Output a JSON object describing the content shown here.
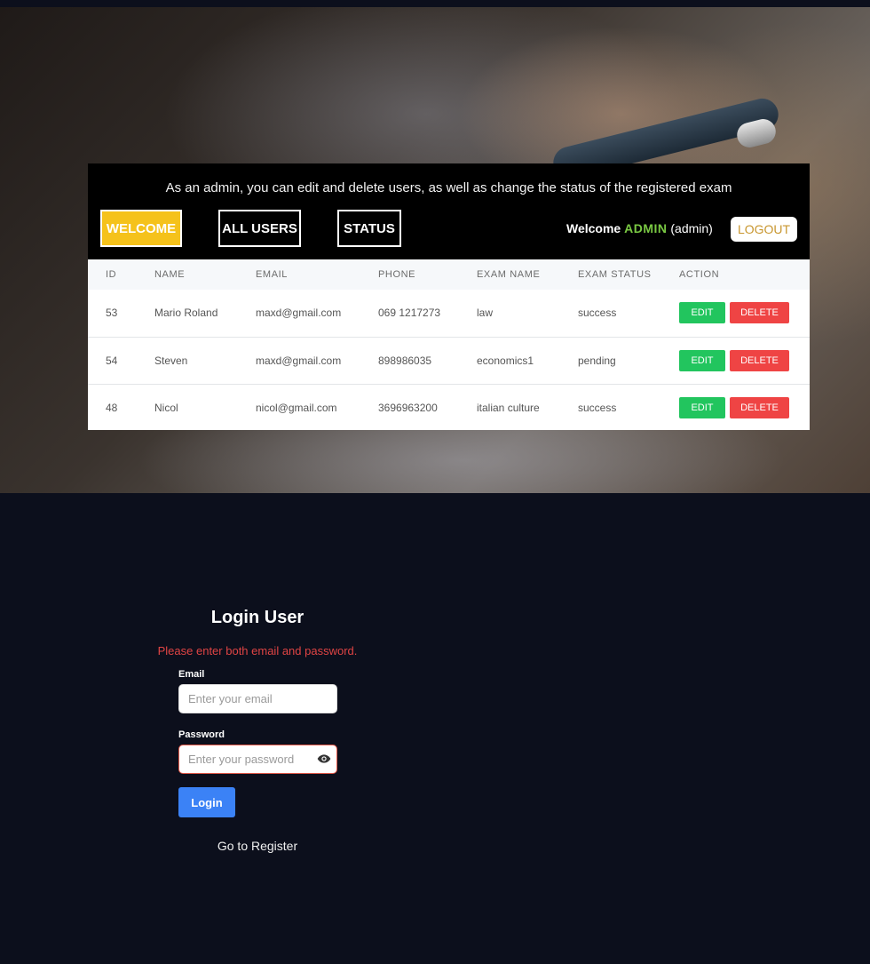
{
  "header": {
    "info_text": "As an admin, you can edit and delete users, as well as change the status of the registered exam",
    "nav": {
      "welcome": "WELCOME",
      "all_users": "ALL USERS",
      "status": "STATUS"
    },
    "welcome_prefix": "Welcome",
    "username": "ADMIN",
    "role": "(admin)",
    "logout": "LOGOUT"
  },
  "table": {
    "columns": [
      "ID",
      "NAME",
      "EMAIL",
      "PHONE",
      "EXAM NAME",
      "EXAM STATUS",
      "ACTION"
    ],
    "rows": [
      {
        "id": "53",
        "name": "Mario Roland",
        "email": "maxd@gmail.com",
        "phone": "069 1217273",
        "exam": "law",
        "status": "success"
      },
      {
        "id": "54",
        "name": "Steven",
        "email": "maxd@gmail.com",
        "phone": "898986035",
        "exam": "economics1",
        "status": "pending"
      },
      {
        "id": "48",
        "name": "Nicol",
        "email": "nicol@gmail.com",
        "phone": "3696963200",
        "exam": "italian culture",
        "status": "success"
      }
    ],
    "edit_label": "EDIT",
    "delete_label": "DELETE"
  },
  "login": {
    "title": "Login User",
    "error": "Please enter both email and password.",
    "email_label": "Email",
    "email_placeholder": "Enter your email",
    "password_label": "Password",
    "password_placeholder": "Enter your password",
    "button": "Login",
    "register_link": "Go to Register"
  },
  "colors": {
    "welcome_bg": "#f5c21b",
    "admin_name": "#7ac943",
    "edit": "#22c55e",
    "delete": "#ef4444",
    "login_button": "#3b82f6",
    "error": "#e04444"
  }
}
